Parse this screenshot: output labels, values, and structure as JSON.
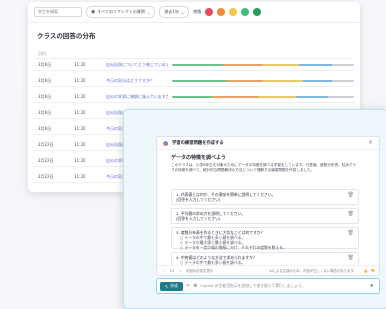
{
  "back": {
    "search_placeholder": "学生を検索",
    "filter_label": "すべてのリフレクトの質問",
    "range_label": "過去1年",
    "emotion_label": "感情",
    "emoji_colors": [
      "#e74c5b",
      "#f08a3c",
      "#f2c94c",
      "#3fbf7f",
      "#2a9d5c"
    ],
    "title": "クラスの回答の分布",
    "table_header": "日付",
    "rows": [
      {
        "date": "3月6日",
        "time": "11:32",
        "q": "自分自身についてどう感じていますか？",
        "segs": [
          28,
          22,
          20,
          18,
          12
        ]
      },
      {
        "date": "3月6日",
        "time": "11:32",
        "q": "今日の気分はどうですか？",
        "segs": [
          30,
          20,
          22,
          16,
          12
        ]
      },
      {
        "date": "3月6日",
        "time": "11:32",
        "q": "自分の学習に順調に進んでいますか？",
        "segs": [
          22,
          26,
          20,
          18,
          14
        ]
      },
      {
        "date": "3月6日",
        "time": "11:32",
        "q": "自分自身についてどう感じていますか？",
        "segs": [
          26,
          24,
          18,
          20,
          12
        ]
      },
      {
        "date": "3月6日",
        "time": "11:32",
        "q": "今日の気分はどうですか？",
        "segs": [
          24,
          22,
          22,
          18,
          14
        ]
      },
      {
        "date": "2月22日",
        "time": "11:32",
        "q": "自分自身についてどう感じていますか？",
        "segs": [
          28,
          20,
          20,
          20,
          12
        ]
      },
      {
        "date": "2月22日",
        "time": "11:32",
        "q": "自分の学習に順調に進んでいますか？",
        "segs": [
          26,
          22,
          22,
          16,
          14
        ]
      },
      {
        "date": "2月22日",
        "time": "11:32",
        "q": "今日の気分はどうですか？",
        "segs": [
          30,
          20,
          18,
          18,
          14
        ]
      }
    ],
    "seg_colors": [
      "#6cc08b",
      "#e6a46b",
      "#e9c86a",
      "#7fb8e0",
      "#cfcfd6"
    ]
  },
  "dialog": {
    "header": "学習の練習問題を作成する",
    "title": "データの特徴を調べよう",
    "desc": "このクラスは、小学6年生を対象のためにデータの特徴を調べる学習をしています。代表値、度数分布表、柱状グラフの特徴を調べて、統計的な問題解決の方法について理解する練習問題を作成しました。",
    "questions": [
      {
        "text": "1. 代表値とは何か、その意味を簡単に説明してください。",
        "answer": "(回答を入力してください)"
      },
      {
        "text": "2. 平均値の求め方を説明してください。",
        "answer": "(回答を入力してください)"
      },
      {
        "text": "3. 度数分布表を作るときに大切なことは何ですか？",
        "options": [
          "データの中で最も多い値を調べる。",
          "データの最大値と最小値を調べる。",
          "データを一定の幅の階級に分け、それぞれの度数を数える。"
        ]
      },
      {
        "text": "4. 中央値はどのような方法で求められますか？",
        "options": [
          "データの中で最も多い値を調べる。",
          "データを小さい順に並べる。"
        ]
      }
    ],
    "footer_left": "1/1",
    "footer_mid": "前回の応答を表示",
    "footer_right": "AIによる生成のため、内容が正しくない場合があります。",
    "input_button": "作成",
    "input_placeholder": "Copilot の生徒用指示を追加して書き換えて実行しましょう。"
  }
}
